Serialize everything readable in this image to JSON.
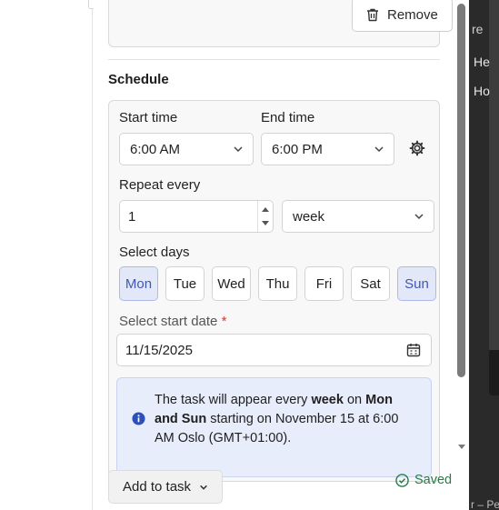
{
  "card": {
    "remove_label": "Remove"
  },
  "schedule": {
    "title": "Schedule",
    "start_time_label": "Start time",
    "end_time_label": "End time",
    "start_time_value": "6:00 AM",
    "end_time_value": "6:00 PM",
    "repeat_label": "Repeat every",
    "repeat_value": "1",
    "repeat_unit": "week",
    "days_label": "Select days",
    "days": [
      {
        "label": "Mon",
        "selected": true
      },
      {
        "label": "Tue",
        "selected": false
      },
      {
        "label": "Wed",
        "selected": false
      },
      {
        "label": "Thu",
        "selected": false
      },
      {
        "label": "Fri",
        "selected": false
      },
      {
        "label": "Sat",
        "selected": false
      },
      {
        "label": "Sun",
        "selected": true
      }
    ],
    "start_date_label": "Select start date",
    "required_marker": "*",
    "start_date_value": "11/15/2025",
    "info": {
      "prefix": "The task will appear every ",
      "unit": "week",
      "on": " on ",
      "days": "Mon and Sun",
      "suffix": " starting on November 15 at 6:00 AM Oslo (GMT+01:00)."
    }
  },
  "footer": {
    "add_to_task_label": "Add to task",
    "saved_label": "Saved"
  },
  "background_window": {
    "line1": "re",
    "line2": "He",
    "line3": "Ho",
    "line4": "r – Pe"
  },
  "colors": {
    "accent": "#3e56b8",
    "active_day_bg": "#e3e8f8",
    "info_bg": "#e8edfb",
    "saved": "#2a7a4a",
    "required": "#c6413a"
  },
  "icons": {
    "remove": "trash-icon",
    "settings": "gear-icon",
    "date": "calendar-icon",
    "info": "info-icon",
    "saved": "check-circle-icon",
    "dropdown": "chevron-down-icon"
  }
}
